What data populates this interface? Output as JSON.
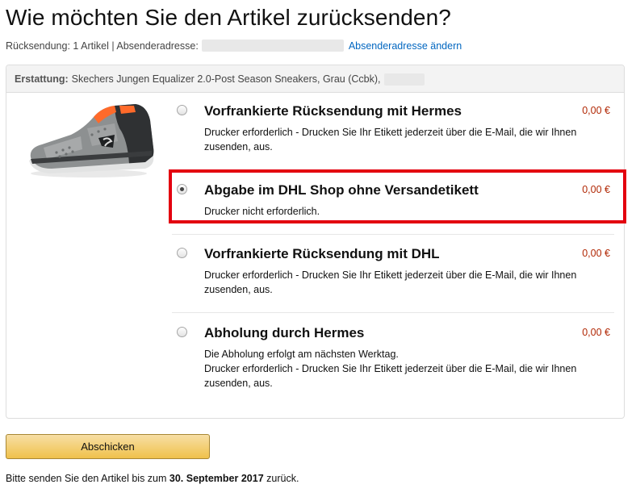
{
  "page": {
    "title": "Wie möchten Sie den Artikel zurücksenden?"
  },
  "subline": {
    "count_text": "Rücksendung: 1 Artikel | Absenderadresse:",
    "change_link": "Absenderadresse ändern"
  },
  "refund": {
    "label": "Erstattung:",
    "item": "Skechers Jungen Equalizer 2.0-Post Season Sneakers, Grau (Ccbk),"
  },
  "product": {
    "image_icon": "sneaker-product-image"
  },
  "options": [
    {
      "title": "Vorfrankierte Rücksendung mit Hermes",
      "price": "0,00 €",
      "desc": "Drucker erforderlich - Drucken Sie Ihr Etikett jederzeit über die E-Mail, die wir Ihnen zusenden, aus.",
      "selected": false
    },
    {
      "title": "Abgabe im DHL Shop ohne Versandetikett",
      "price": "0,00 €",
      "desc": "Drucker nicht erforderlich.",
      "selected": true
    },
    {
      "title": "Vorfrankierte Rücksendung mit DHL",
      "price": "0,00 €",
      "desc": "Drucker erforderlich - Drucken Sie Ihr Etikett jederzeit über die E-Mail, die wir Ihnen zusenden, aus.",
      "selected": false
    },
    {
      "title": "Abholung durch Hermes",
      "price": "0,00 €",
      "desc_line1": "Die Abholung erfolgt am nächsten Werktag.",
      "desc": "Drucker erforderlich - Drucken Sie Ihr Etikett jederzeit über die E-Mail, die wir Ihnen zusenden, aus.",
      "selected": false
    }
  ],
  "submit": {
    "label": "Abschicken"
  },
  "footer": {
    "before": "Bitte senden Sie den Artikel bis zum",
    "date": "30. September 2017",
    "after": "zurück."
  },
  "colors": {
    "link": "#0066c0",
    "price": "#b12704",
    "highlight": "#e3000f",
    "button": "#f0c14b"
  }
}
